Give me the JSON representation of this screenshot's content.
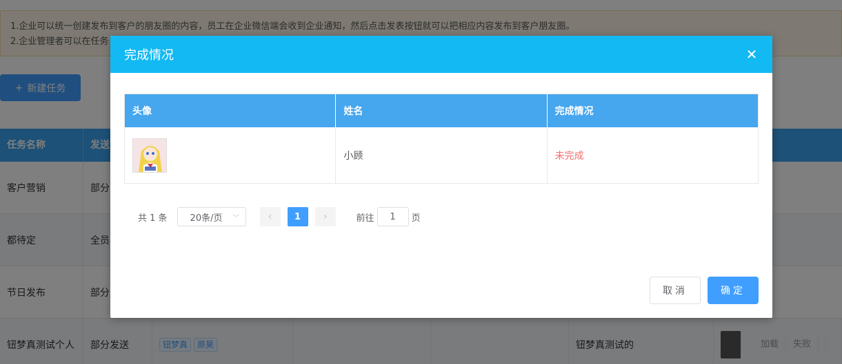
{
  "background": {
    "notice_lines": [
      "1.企业可以统一创建发布到客户的朋友圈的内容，员工在企业微信端会收到企业通知，然后点击发表按钮就可以把相应内容发布到客户朋友圈。",
      "2.企业管理者可以在任务"
    ],
    "new_task_label": "新建任务",
    "table_headers": [
      "任务名称",
      "发送"
    ],
    "rows": [
      {
        "name": "客户营销",
        "send": "部分"
      },
      {
        "name": "都待定",
        "send": "全员"
      },
      {
        "name": "节日发布",
        "send": "部分"
      },
      {
        "name": "钮梦真测试个人",
        "send": "部分发送",
        "tags": [
          "钮梦真",
          "原昊"
        ],
        "creator": "钮梦真测试的",
        "load_status": [
          "加载",
          "失败"
        ]
      }
    ]
  },
  "dialog": {
    "title": "完成情况",
    "columns": [
      "头像",
      "姓名",
      "完成情况"
    ],
    "rows": [
      {
        "name": "小顾",
        "status": "未完成"
      }
    ],
    "pagination": {
      "total_label": "共 1 条",
      "page_size": "20条/页",
      "current_page": "1",
      "goto_prefix": "前往",
      "goto_value": "1",
      "goto_suffix": "页"
    },
    "cancel_label": "取消",
    "ok_label": "确定"
  },
  "colors": {
    "header": "#12b9f3",
    "table_header": "#46a6ee",
    "primary": "#409eff",
    "danger": "#f56c6c"
  }
}
